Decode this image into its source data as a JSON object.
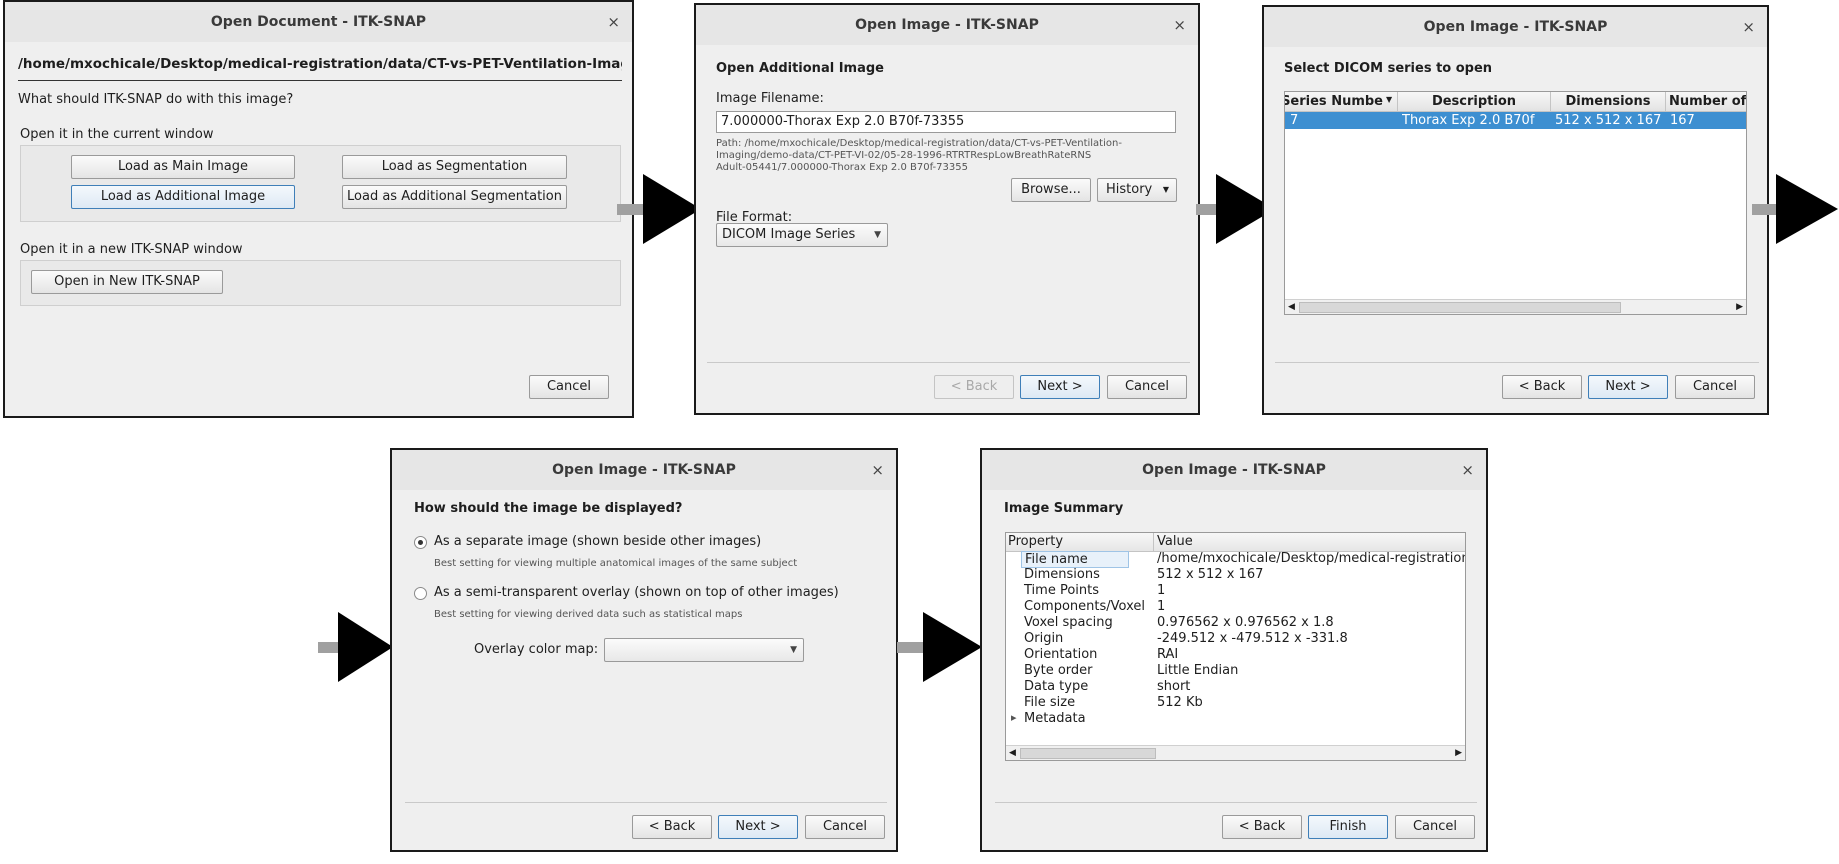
{
  "colors": {
    "selection": "#3d8fd1",
    "arrow": "#000000",
    "dialog_bg": "#efefef"
  },
  "dialog1": {
    "title": "Open Document - ITK-SNAP",
    "close": "×",
    "path": "/home/mxochicale/Desktop/medical-registration/data/CT-vs-PET-Ventilation-Imagin",
    "question": "What should ITK-SNAP do with this image?",
    "current_window_label": "Open it in the current window",
    "load_main": "Load as Main Image",
    "load_seg": "Load as Segmentation",
    "load_additional": "Load as Additional Image",
    "load_additional_seg": "Load as Additional Segmentation",
    "new_window_label": "Open it in a new ITK-SNAP window",
    "open_new": "Open in New ITK-SNAP",
    "cancel": "Cancel"
  },
  "dialog2": {
    "title": "Open Image - ITK-SNAP",
    "close": "×",
    "heading": "Open Additional Image",
    "filename_label": "Image Filename:",
    "filename_value": "7.000000-Thorax Exp  2.0  B70f-73355",
    "path_line1": "Path: /home/mxochicale/Desktop/medical-registration/data/CT-vs-PET-Ventilation-",
    "path_line2": "Imaging/demo-data/CT-PET-VI-02/05-28-1996-RTRTRespLowBreathRateRNS",
    "path_line3": "Adult-05441/7.000000-Thorax Exp  2.0  B70f-73355",
    "browse": "Browse...",
    "history": "History",
    "format_label": "File Format:",
    "format_value": "DICOM Image Series",
    "back": "< Back",
    "next": "Next >",
    "cancel": "Cancel"
  },
  "dialog3": {
    "title": "Open Image - ITK-SNAP",
    "close": "×",
    "heading": "Select DICOM series to open",
    "columns": [
      "Series Numbe",
      "Description",
      "Dimensions",
      "Number of"
    ],
    "rows": [
      [
        "7",
        "Thorax Exp  2.0  B70f",
        "512 x 512 x 167",
        "167"
      ]
    ],
    "back": "< Back",
    "next": "Next >",
    "cancel": "Cancel"
  },
  "dialog4": {
    "title": "Open Image - ITK-SNAP",
    "close": "×",
    "heading": "How should the image be displayed?",
    "option1": "As a separate image (shown beside other images)",
    "option1_hint": "Best setting for viewing multiple anatomical images of the same subject",
    "option2": "As a semi-transparent overlay (shown on top of other images)",
    "option2_hint": "Best setting for viewing derived data such as statistical maps",
    "colormap_label": "Overlay color map:",
    "colormap_value": "",
    "back": "< Back",
    "next": "Next >",
    "cancel": "Cancel"
  },
  "dialog5": {
    "title": "Open Image - ITK-SNAP",
    "close": "×",
    "heading": "Image Summary",
    "col_property": "Property",
    "col_value": "Value",
    "rows": [
      [
        "File name",
        "/home/mxochicale/Desktop/medical-registration"
      ],
      [
        "Dimensions",
        "512 x 512 x 167"
      ],
      [
        "Time Points",
        "1"
      ],
      [
        "Components/Voxel",
        "1"
      ],
      [
        "Voxel spacing",
        "0.976562 x 0.976562 x 1.8"
      ],
      [
        "Origin",
        "-249.512 x -479.512 x -331.8"
      ],
      [
        "Orientation",
        "RAI"
      ],
      [
        "Byte order",
        "Little Endian"
      ],
      [
        "Data type",
        "short"
      ],
      [
        "File size",
        "512 Kb"
      ],
      [
        "Metadata",
        ""
      ]
    ],
    "back": "< Back",
    "finish": "Finish",
    "cancel": "Cancel"
  }
}
